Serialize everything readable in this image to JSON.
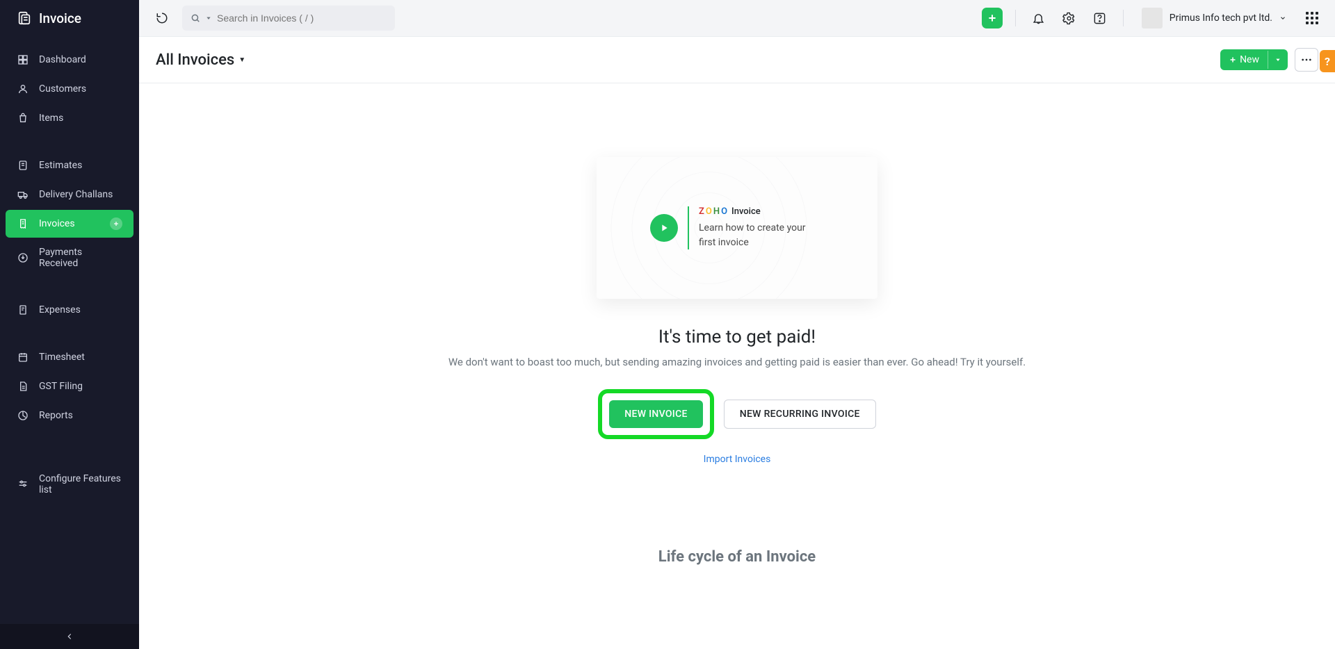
{
  "app_name": "Invoice",
  "sidebar": {
    "items": [
      {
        "label": "Dashboard",
        "icon": "dashboard-icon"
      },
      {
        "label": "Customers",
        "icon": "person-icon"
      },
      {
        "label": "Items",
        "icon": "bag-icon"
      },
      {
        "gap": true
      },
      {
        "label": "Estimates",
        "icon": "estimate-icon"
      },
      {
        "label": "Delivery Challans",
        "icon": "truck-icon"
      },
      {
        "label": "Invoices",
        "icon": "invoice-icon",
        "active": true,
        "has_add": true
      },
      {
        "label": "Payments Received",
        "icon": "download-icon"
      },
      {
        "gap": true
      },
      {
        "label": "Expenses",
        "icon": "receipt-icon"
      },
      {
        "gap": true
      },
      {
        "label": "Timesheet",
        "icon": "calendar-icon"
      },
      {
        "label": "GST Filing",
        "icon": "doc-icon"
      },
      {
        "label": "Reports",
        "icon": "chart-icon"
      },
      {
        "gap": true
      },
      {
        "gap": true
      },
      {
        "label": "Configure Features list",
        "icon": "sliders-icon"
      }
    ]
  },
  "topbar": {
    "search_placeholder": "Search in Invoices ( / )",
    "org_label": "Primus Info tech pvt ltd."
  },
  "page": {
    "title": "All Invoices",
    "new_button": "New",
    "help_label": "?"
  },
  "video": {
    "logo_suffix": "Invoice",
    "description": "Learn how to create your first invoice"
  },
  "empty": {
    "heading": "It's time to get paid!",
    "subheading": "We don't want to boast too much, but sending amazing invoices and getting paid is easier than ever. Go ahead! Try it yourself.",
    "primary_cta": "NEW INVOICE",
    "secondary_cta": "NEW RECURRING INVOICE",
    "import_link": "Import Invoices",
    "lifecycle_heading": "Life cycle of an Invoice"
  }
}
